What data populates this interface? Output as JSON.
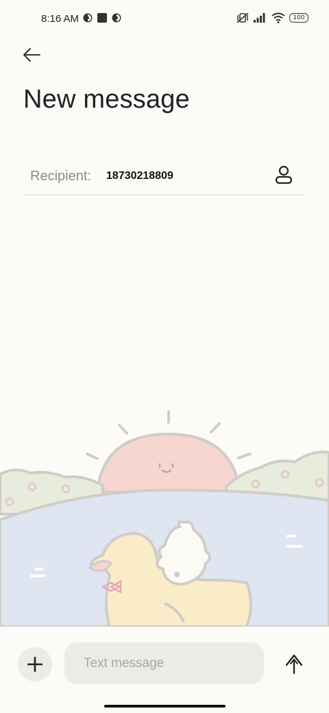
{
  "status_bar": {
    "time": "8:16 AM",
    "battery": "100",
    "icons_left": [
      "sync-icon",
      "square-icon",
      "sync-icon"
    ],
    "icons_right": [
      "muted-vibrate-icon",
      "signal-icon",
      "wifi-icon",
      "battery-icon"
    ]
  },
  "header": {
    "back_icon": "arrow-left-icon",
    "title": "New message"
  },
  "recipient": {
    "label": "Recipient:",
    "value": "18730218809",
    "contact_icon": "person-icon"
  },
  "composer": {
    "add_icon": "plus-icon",
    "placeholder": "Text message",
    "value": "",
    "send_icon": "arrow-up-icon"
  },
  "colors": {
    "background": "#fcfbf7",
    "input_bg": "#ecebe7",
    "sun": "#f6d6cf",
    "water": "#e0e5f2",
    "bushes": "#e8ecdc",
    "duck": "#fbecc9"
  }
}
